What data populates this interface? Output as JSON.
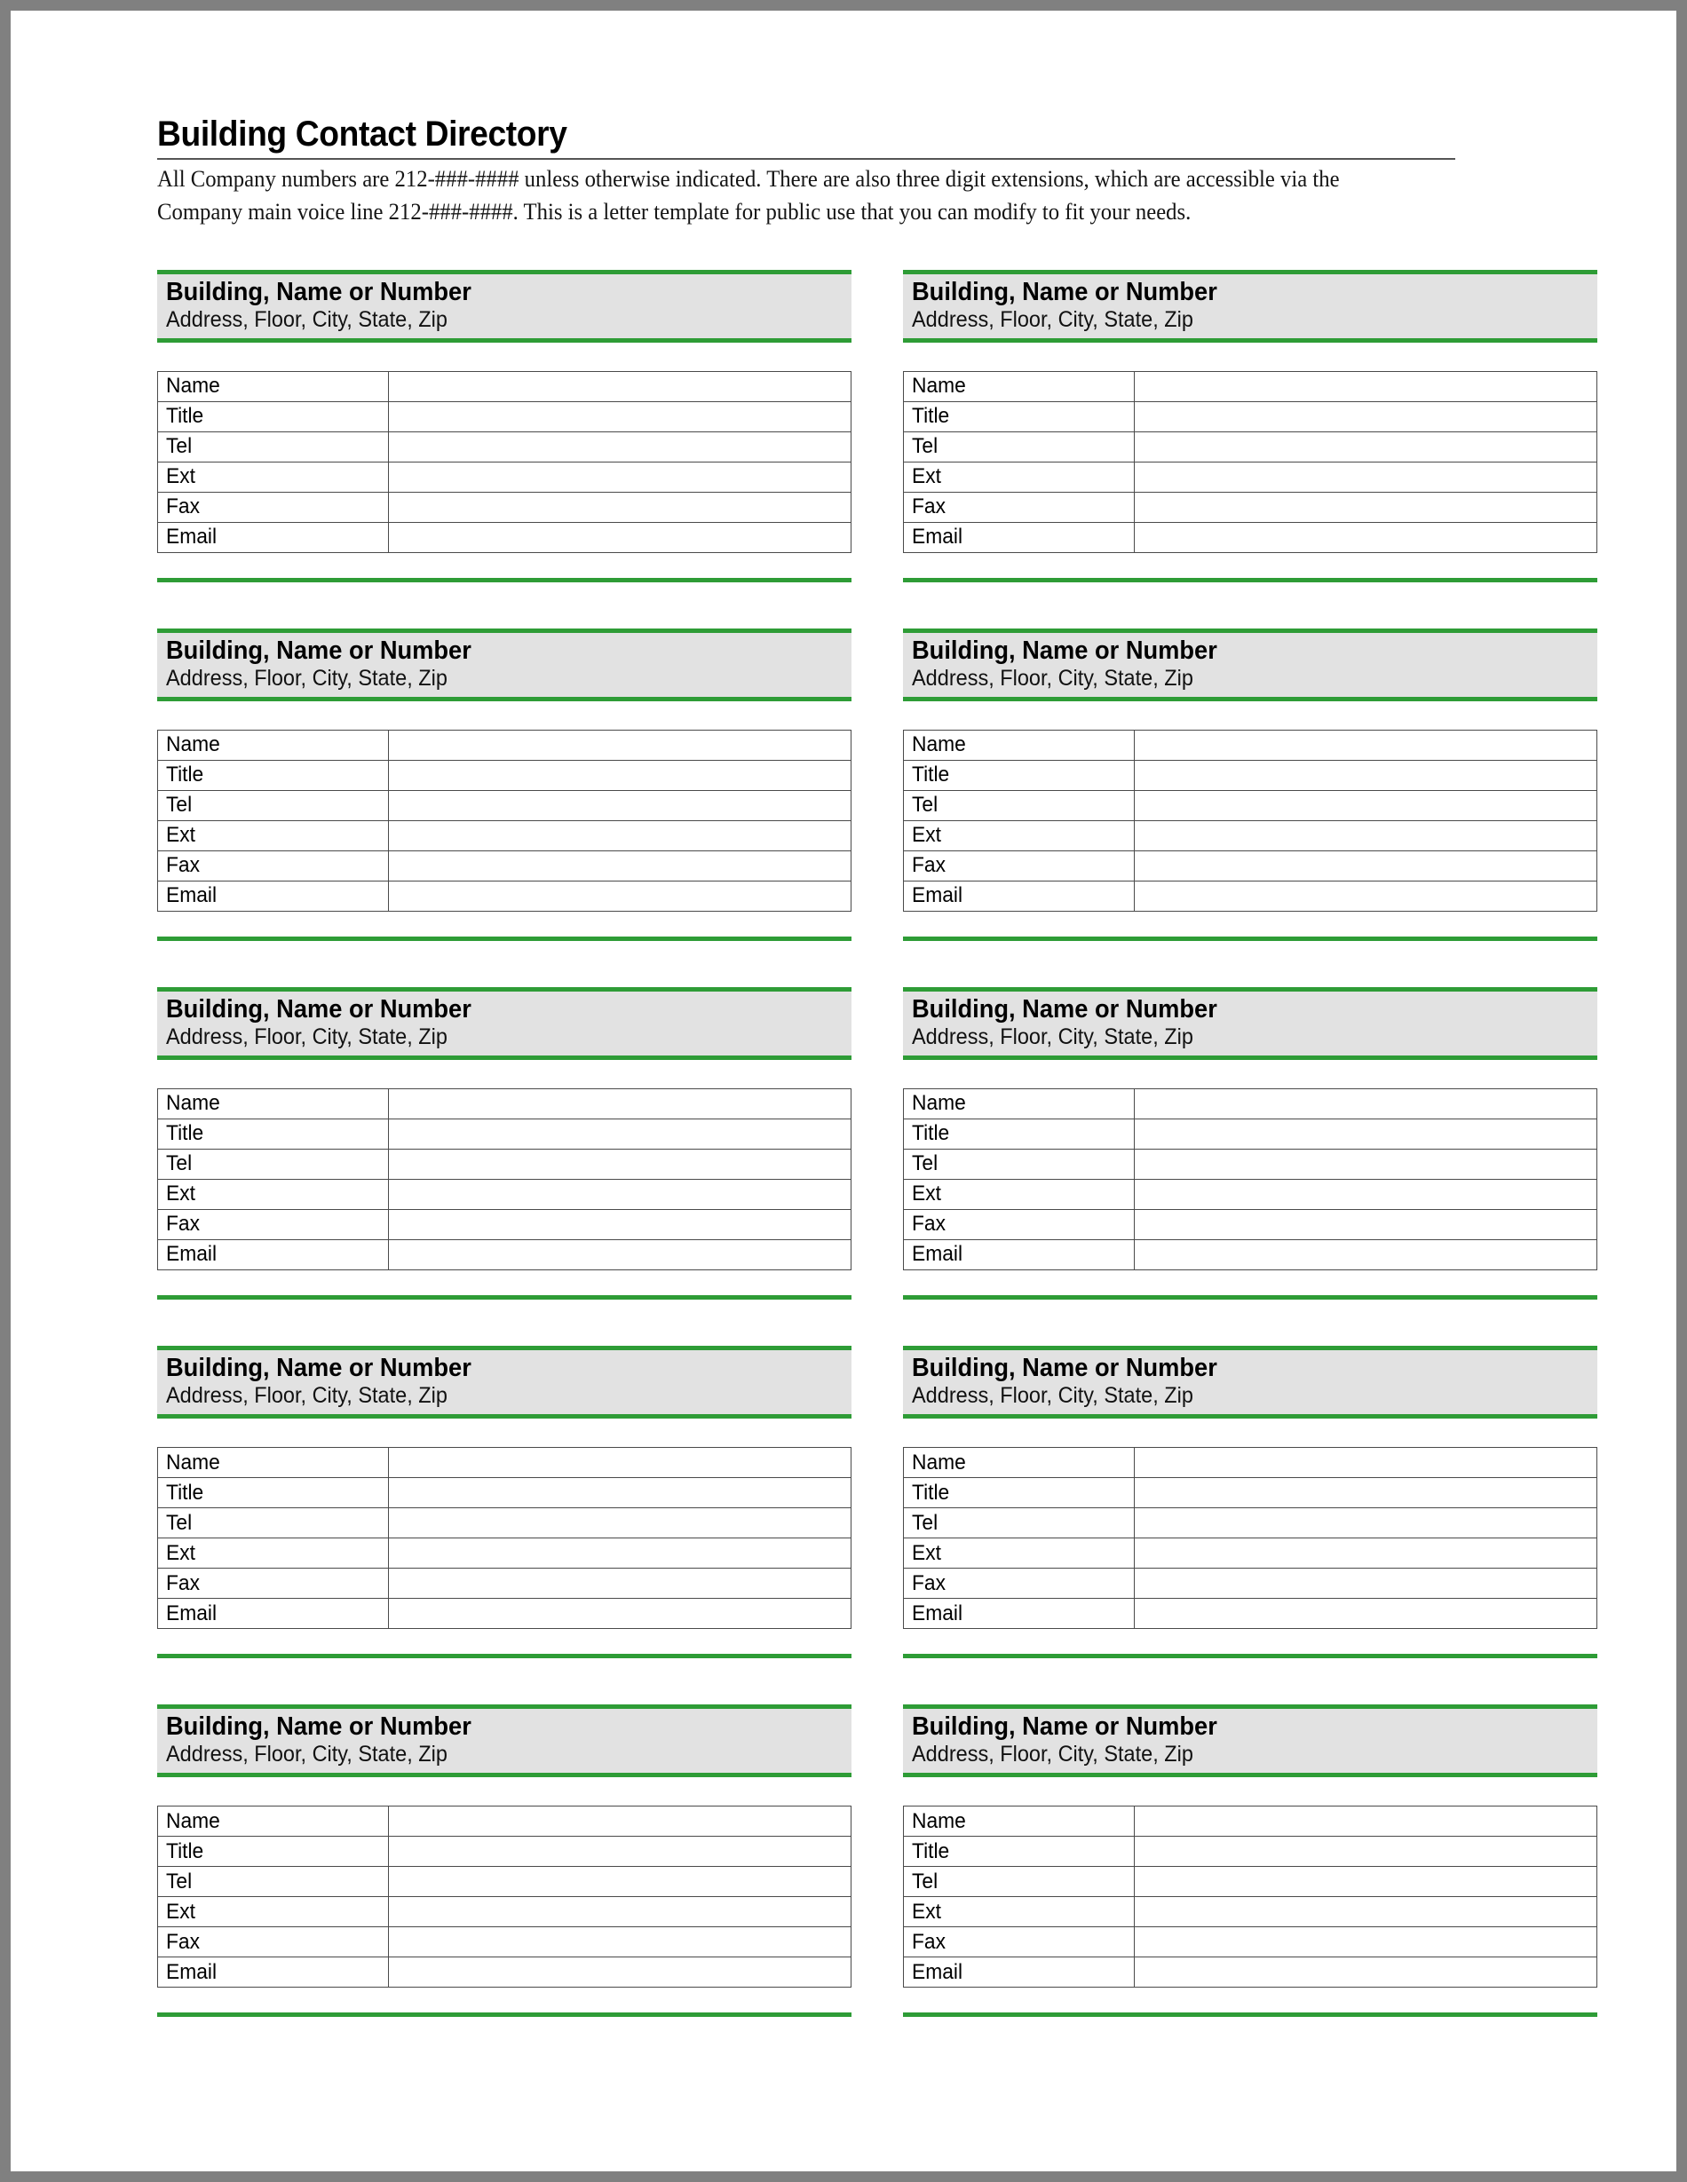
{
  "document": {
    "title": "Building Contact Directory",
    "intro": "All Company numbers are 212-###-#### unless otherwise indicated.  There are also three digit extensions, which are accessible via the Company main voice line 212-###-####. This is a letter template for public use that you can modify to fit your needs."
  },
  "theme": {
    "accent_green": "#2e9c36",
    "header_gray": "#e2e2e2",
    "page_frame_gray": "#808080",
    "rule_gray": "#555555",
    "table_border": "#4a4a4a"
  },
  "card_defaults": {
    "title": "Building, Name or Number",
    "subtitle": "Address, Floor, City, State, Zip",
    "row_labels": [
      "Name",
      "Title",
      "Tel",
      "Ext",
      "Fax",
      "Email"
    ],
    "row_values": [
      "",
      "",
      "",
      "",
      "",
      ""
    ]
  },
  "cards": [
    {
      "title": "Building, Name or Number",
      "subtitle": "Address, Floor, City, State, Zip",
      "rows": [
        {
          "label": "Name",
          "value": ""
        },
        {
          "label": "Title",
          "value": ""
        },
        {
          "label": "Tel",
          "value": ""
        },
        {
          "label": "Ext",
          "value": ""
        },
        {
          "label": "Fax",
          "value": ""
        },
        {
          "label": "Email",
          "value": ""
        }
      ]
    },
    {
      "title": "Building, Name or Number",
      "subtitle": "Address, Floor, City, State, Zip",
      "rows": [
        {
          "label": "Name",
          "value": ""
        },
        {
          "label": "Title",
          "value": ""
        },
        {
          "label": "Tel",
          "value": ""
        },
        {
          "label": "Ext",
          "value": ""
        },
        {
          "label": "Fax",
          "value": ""
        },
        {
          "label": "Email",
          "value": ""
        }
      ]
    },
    {
      "title": "Building, Name or Number",
      "subtitle": "Address, Floor, City, State, Zip",
      "rows": [
        {
          "label": "Name",
          "value": ""
        },
        {
          "label": "Title",
          "value": ""
        },
        {
          "label": "Tel",
          "value": ""
        },
        {
          "label": "Ext",
          "value": ""
        },
        {
          "label": "Fax",
          "value": ""
        },
        {
          "label": "Email",
          "value": ""
        }
      ]
    },
    {
      "title": "Building, Name or Number",
      "subtitle": "Address, Floor, City, State, Zip",
      "rows": [
        {
          "label": "Name",
          "value": ""
        },
        {
          "label": "Title",
          "value": ""
        },
        {
          "label": "Tel",
          "value": ""
        },
        {
          "label": "Ext",
          "value": ""
        },
        {
          "label": "Fax",
          "value": ""
        },
        {
          "label": "Email",
          "value": ""
        }
      ]
    },
    {
      "title": "Building, Name or Number",
      "subtitle": "Address, Floor, City, State, Zip",
      "rows": [
        {
          "label": "Name",
          "value": ""
        },
        {
          "label": "Title",
          "value": ""
        },
        {
          "label": "Tel",
          "value": ""
        },
        {
          "label": "Ext",
          "value": ""
        },
        {
          "label": "Fax",
          "value": ""
        },
        {
          "label": "Email",
          "value": ""
        }
      ]
    },
    {
      "title": "Building, Name or Number",
      "subtitle": "Address, Floor, City, State, Zip",
      "rows": [
        {
          "label": "Name",
          "value": ""
        },
        {
          "label": "Title",
          "value": ""
        },
        {
          "label": "Tel",
          "value": ""
        },
        {
          "label": "Ext",
          "value": ""
        },
        {
          "label": "Fax",
          "value": ""
        },
        {
          "label": "Email",
          "value": ""
        }
      ]
    },
    {
      "title": "Building, Name or Number",
      "subtitle": "Address, Floor, City, State, Zip",
      "rows": [
        {
          "label": "Name",
          "value": ""
        },
        {
          "label": "Title",
          "value": ""
        },
        {
          "label": "Tel",
          "value": ""
        },
        {
          "label": "Ext",
          "value": ""
        },
        {
          "label": "Fax",
          "value": ""
        },
        {
          "label": "Email",
          "value": ""
        }
      ]
    },
    {
      "title": "Building, Name or Number",
      "subtitle": "Address, Floor, City, State, Zip",
      "rows": [
        {
          "label": "Name",
          "value": ""
        },
        {
          "label": "Title",
          "value": ""
        },
        {
          "label": "Tel",
          "value": ""
        },
        {
          "label": "Ext",
          "value": ""
        },
        {
          "label": "Fax",
          "value": ""
        },
        {
          "label": "Email",
          "value": ""
        }
      ]
    },
    {
      "title": "Building, Name or Number",
      "subtitle": "Address, Floor, City, State, Zip",
      "rows": [
        {
          "label": "Name",
          "value": ""
        },
        {
          "label": "Title",
          "value": ""
        },
        {
          "label": "Tel",
          "value": ""
        },
        {
          "label": "Ext",
          "value": ""
        },
        {
          "label": "Fax",
          "value": ""
        },
        {
          "label": "Email",
          "value": ""
        }
      ]
    },
    {
      "title": "Building, Name or Number",
      "subtitle": "Address, Floor, City, State, Zip",
      "rows": [
        {
          "label": "Name",
          "value": ""
        },
        {
          "label": "Title",
          "value": ""
        },
        {
          "label": "Tel",
          "value": ""
        },
        {
          "label": "Ext",
          "value": ""
        },
        {
          "label": "Fax",
          "value": ""
        },
        {
          "label": "Email",
          "value": ""
        }
      ]
    }
  ]
}
